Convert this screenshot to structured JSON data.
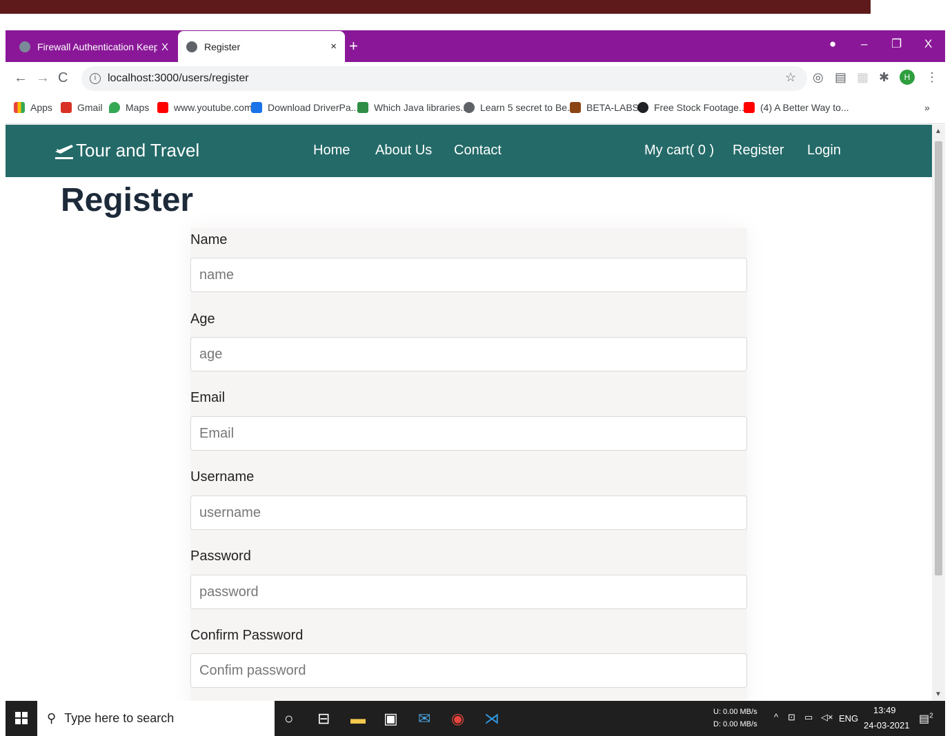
{
  "browser": {
    "tabs": [
      {
        "title": "Firewall Authentication Keepalive",
        "close": "X"
      },
      {
        "title": "Register",
        "close": "×"
      }
    ],
    "new_tab": "+",
    "window_controls": {
      "minimize": "–",
      "restore": "❐",
      "close": "X"
    },
    "url": "localhost:3000/users/register",
    "bookmarks": [
      {
        "label": "Apps",
        "color": "#e8453c"
      },
      {
        "label": "Gmail",
        "color": "#d93025"
      },
      {
        "label": "Maps",
        "color": "#34a853"
      },
      {
        "label": "www.youtube.com",
        "color": "#ff0000"
      },
      {
        "label": "Download DriverPa...",
        "color": "#1a73e8"
      },
      {
        "label": "Which Java libraries...",
        "color": "#2f8d46"
      },
      {
        "label": "Learn 5 secret to Be...",
        "color": "#5f6368"
      },
      {
        "label": "BETA-LABS",
        "color": "#8b4513"
      },
      {
        "label": "Free Stock Footage...",
        "color": "#202124"
      },
      {
        "label": "(4) A Better Way to...",
        "color": "#ff0000"
      }
    ],
    "bookmarks_more": "»",
    "profile_initial": "H"
  },
  "site": {
    "brand": "Tour and Travel",
    "nav": [
      {
        "label": "Home"
      },
      {
        "label": "About Us"
      },
      {
        "label": "Contact"
      },
      {
        "label": "My cart( 0 )"
      },
      {
        "label": "Register"
      },
      {
        "label": "Login"
      }
    ],
    "page_title": "Register",
    "fields": [
      {
        "label": "Name",
        "placeholder": "name"
      },
      {
        "label": "Age",
        "placeholder": "age"
      },
      {
        "label": "Email",
        "placeholder": "Email"
      },
      {
        "label": "Username",
        "placeholder": "username"
      },
      {
        "label": "Password",
        "placeholder": "password"
      },
      {
        "label": "Confirm Password",
        "placeholder": "Confim password"
      }
    ],
    "colors": {
      "nav_bg": "#236a68",
      "title": "#1d2a3a"
    }
  },
  "taskbar": {
    "search_placeholder": "Type here to search",
    "net_up": "U:    0.00 MB/s",
    "net_down": "D:    0.00 MB/s",
    "language": "ENG",
    "time": "13:49",
    "date": "24-03-2021",
    "notifications": "2"
  }
}
